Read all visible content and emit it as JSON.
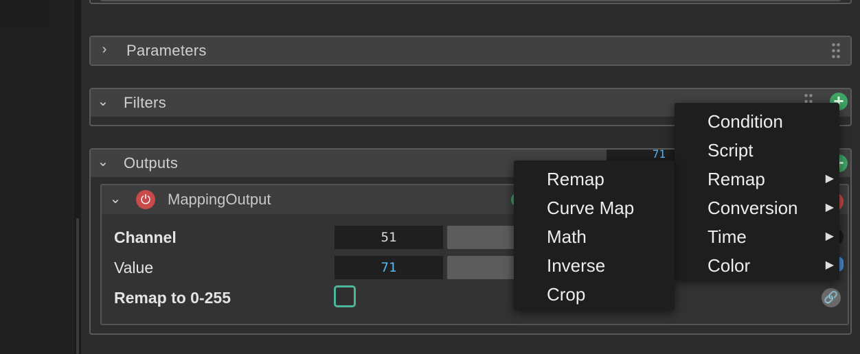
{
  "panels": {
    "parameters": {
      "title": "Parameters"
    },
    "filters": {
      "title": "Filters"
    },
    "outputs": {
      "title": "Outputs",
      "header_value_partial": "71"
    }
  },
  "mapping_output": {
    "title": "MappingOutput",
    "params": [
      {
        "label": "Channel",
        "value": "51"
      },
      {
        "label": "Value",
        "value": "71"
      },
      {
        "label": "Remap to 0-255"
      }
    ]
  },
  "filter_menu": {
    "items": [
      "Condition",
      "Script",
      "Remap",
      "Conversion",
      "Time",
      "Color"
    ],
    "submenu_indicators": [
      "Remap",
      "Conversion",
      "Time",
      "Color"
    ]
  },
  "remap_submenu": {
    "items": [
      "Remap",
      "Curve Map",
      "Math",
      "Inverse",
      "Crop"
    ]
  },
  "icons": {
    "expand": "chevron-right-icon",
    "collapse": "chevron-down-icon",
    "grip": "drag-grip-icon",
    "add": "plus-icon",
    "power": "power-icon",
    "link": "link-icon",
    "submenu": "caret-right-icon"
  },
  "colors": {
    "add_button": "#3fa464",
    "power_button": "#c94a4a",
    "value_text": "#5bb8f5",
    "checkbox_border": "#4fb59a"
  }
}
